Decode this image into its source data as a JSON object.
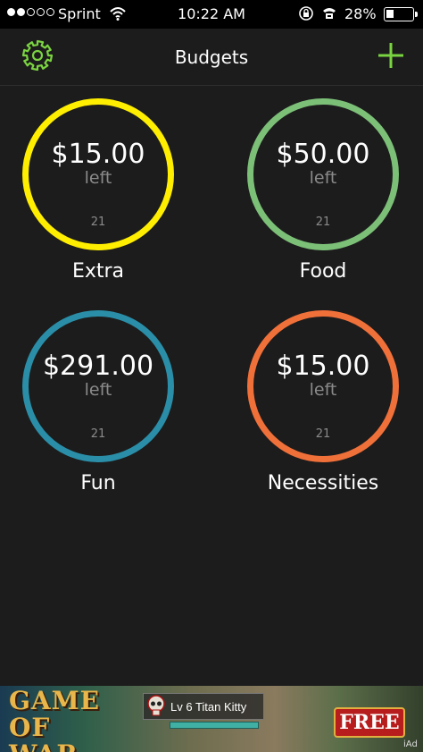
{
  "status_bar": {
    "carrier": "Sprint",
    "time": "10:22 AM",
    "battery": "28%",
    "battery_level": 0.28,
    "signal_bars": 2,
    "signal_total": 5
  },
  "nav": {
    "title": "Budgets",
    "settings_icon": "gear-icon",
    "add_icon": "plus-icon",
    "accent_color": "#7ad341"
  },
  "budgets": [
    {
      "amount": "$15.00",
      "left_label": "left",
      "day": "21",
      "name": "Extra",
      "color": "#ffee00"
    },
    {
      "amount": "$50.00",
      "left_label": "left",
      "day": "21",
      "name": "Food",
      "color": "#7cc078"
    },
    {
      "amount": "$291.00",
      "left_label": "left",
      "day": "21",
      "name": "Fun",
      "color": "#2a8ea8"
    },
    {
      "amount": "$15.00",
      "left_label": "left",
      "day": "21",
      "name": "Necessities",
      "color": "#f0703a"
    }
  ],
  "ad": {
    "title": "GAME\nOF\nWAR",
    "kitty_label": "Lv 6 Titan Kitty",
    "cta": "FREE",
    "iad": "iAd"
  }
}
